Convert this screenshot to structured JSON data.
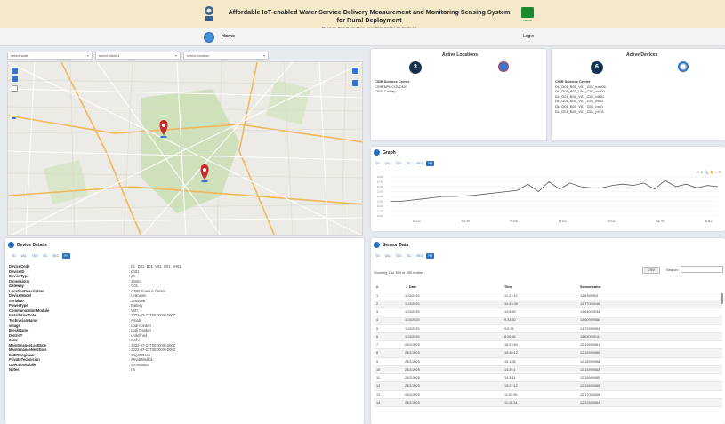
{
  "header": {
    "title": "Affordable IoT-enabled Water Service Delivery Measurement and Monitoring Sensing System for Rural Deployment",
    "subtitle": "Gaon Ka Pani Gaon Main - Har Ghar Ko Nal Se Saph Jal",
    "brand_text": "NEERI"
  },
  "nav": {
    "home": "Home",
    "login": "Login"
  },
  "filters": [
    {
      "placeholder": "select state"
    },
    {
      "placeholder": "select district"
    },
    {
      "placeholder": "select location"
    }
  ],
  "active_locations": {
    "title": "Active Locations",
    "count": "3",
    "items": [
      "CSIR Science Center",
      "CSIR NPL COLONY",
      "CSIO Colony"
    ]
  },
  "active_devices": {
    "title": "Active Devices",
    "count": "6",
    "items": [
      "CSIR Science Center",
      "DL_D01_B01_V01_G01_turb06",
      "DL_D01_B01_V01_G01_ssd01",
      "DL_D01_B01_V01_G01_tds01",
      "DL_D01_B01_V01_G01_ec01",
      "DL_D01_B01_V01_G01_ps01",
      "DL_D01_B01_V01_G01_pH01"
    ]
  },
  "graph": {
    "title": "Graph",
    "tabs": [
      "TD",
      "VAL",
      "TDS",
      "EC",
      "SEC",
      "PH"
    ],
    "active_tab": "PH",
    "y_ticks": [
      "12.60",
      "12.40",
      "12.20",
      "12.00",
      "11.80",
      "11.60",
      "11.40",
      "11.20",
      "11.00"
    ],
    "x_ticks": [
      "22 Jan",
      "Feb '25",
      "05 Feb",
      "19 Feb",
      "26 Feb",
      "Mar '25",
      "09 Mar"
    ]
  },
  "chart_data": {
    "type": "line",
    "ylim": [
      11.0,
      12.6
    ],
    "series": [
      {
        "values": [
          11.6,
          11.6,
          11.65,
          11.7,
          11.75,
          11.8,
          11.8,
          11.82,
          11.85,
          11.9,
          11.95,
          12.0,
          12.05,
          12.3,
          12.0,
          12.4,
          12.1,
          12.35,
          12.2,
          12.15,
          12.15,
          12.25,
          12.3,
          12.25,
          12.35,
          12.1,
          12.45,
          12.2,
          12.3,
          12.15,
          12.25,
          12.2
        ]
      }
    ]
  },
  "device_details": {
    "title": "Device Details",
    "tabs": [
      "TD",
      "VAL",
      "TDS",
      "EC",
      "SEC",
      "PH"
    ],
    "active_tab": "PH",
    "rows": [
      [
        "DeviceCode",
        ": DL_D01_B01_V01_G01_pH01"
      ],
      [
        "DeviceID",
        ": ph01"
      ],
      [
        "DeviceType",
        ": ph"
      ],
      [
        "Dimensions",
        ": 34mm"
      ],
      [
        "Gateway",
        ": G01"
      ],
      [
        "LocationDescription",
        ": CSIR Science Center"
      ],
      [
        "DeviceModel",
        ": Unknown"
      ],
      [
        "SerialNo",
        ": 3454656"
      ],
      [
        "PowerType",
        ": Battery"
      ],
      [
        "CommunicationModule",
        ": WiFi"
      ],
      [
        "InstallationDate",
        ": 2022-07-27T00:00:00.000Z"
      ],
      [
        "TechnicianName",
        ": Arnab"
      ],
      [
        "village",
        ": Lodi Garden"
      ],
      [
        "BlockName",
        ": Lodi Garden"
      ],
      [
        "DistricT",
        ": undefined"
      ],
      [
        "State",
        ": Delhi"
      ],
      [
        "MaintenanceLastDate",
        ": 2022-07-27T00:00:00.000Z"
      ],
      [
        "MaintenanceNextDate",
        ": 2022-07-27T00:00:00.000Z"
      ],
      [
        "PHEDEngineer",
        ": Sagar Rana"
      ],
      [
        "PrivateTechnician",
        ": Arnab Mallick"
      ],
      [
        "OperatorMobile",
        ": 987893663"
      ],
      [
        "Notes",
        ": na"
      ]
    ]
  },
  "sensor_data": {
    "title": "Sensor Data",
    "tabs": [
      "TD",
      "VAL",
      "TDS",
      "EC",
      "SEC",
      "PH"
    ],
    "active_tab": "PH",
    "info": "Showing 1 to 359 of 359 entries",
    "csv_label": "CSV",
    "search_label": "Search:",
    "columns": [
      "#",
      "Date",
      "Time",
      "Sensor value"
    ],
    "rows": [
      [
        "1",
        "11/3/2025",
        "11:17:43",
        "13.8399963"
      ],
      [
        "2",
        "11/3/2025",
        "10:43:38",
        "13.77000046"
      ],
      [
        "3",
        "11/3/2025",
        "10:8:45",
        "13.64000034"
      ],
      [
        "4",
        "11/3/2025",
        "9:34:30",
        "13.60999966"
      ],
      [
        "5",
        "11/3/2025",
        "9:0:34",
        "13.72999954"
      ],
      [
        "6",
        "11/3/2025",
        "8:26:54",
        "13.63000011"
      ],
      [
        "7",
        "28/2/2025",
        "16:23:54",
        "12.19999981"
      ],
      [
        "8",
        "28/2/2025",
        "15:46:12",
        "12.15999985"
      ],
      [
        "9",
        "28/2/2025",
        "15:1:35",
        "12.18999958"
      ],
      [
        "10",
        "28/2/2025",
        "14:26:1",
        "12.13999963"
      ],
      [
        "11",
        "28/2/2025",
        "14:3:11",
        "12.15999985"
      ],
      [
        "12",
        "28/2/2025",
        "13:27:12",
        "12.15999985"
      ],
      [
        "13",
        "28/2/2025",
        "11:52:56",
        "12.17000008"
      ],
      [
        "14",
        "28/2/2025",
        "11:18:34",
        "12.22999954"
      ]
    ]
  }
}
